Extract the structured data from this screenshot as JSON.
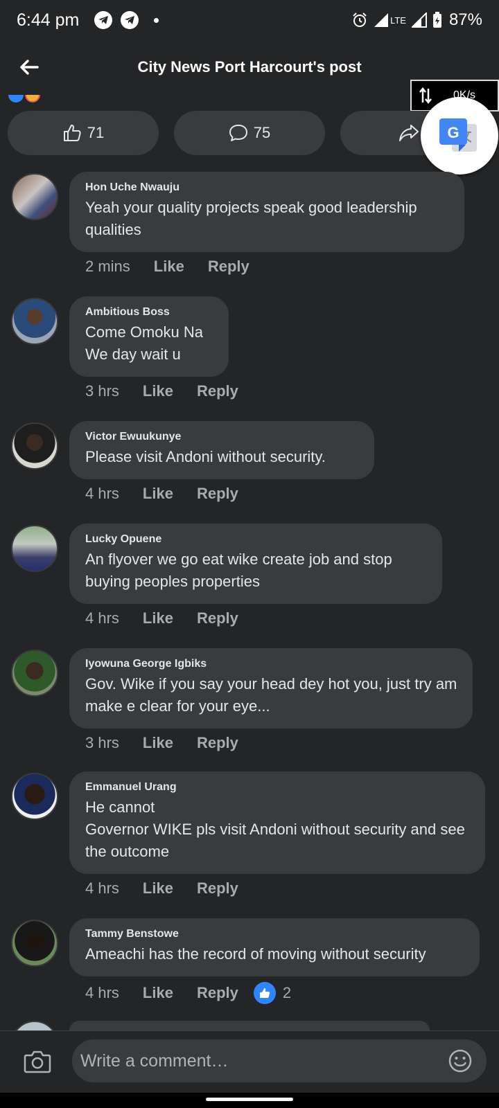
{
  "status_bar": {
    "time": "6:44 pm",
    "network": "LTE",
    "battery": "87%"
  },
  "header": {
    "title": "City News Port Harcourt's post"
  },
  "speed_indicator": {
    "value": "0K/s"
  },
  "actions": {
    "like_count": "71",
    "comment_count": "75"
  },
  "comments": [
    {
      "author": "Hon Uche Nwauju",
      "text": "Yeah your quality projects speak good leadership qualities",
      "time": "2 mins",
      "like_label": "Like",
      "reply_label": "Reply"
    },
    {
      "author": "Ambitious Boss",
      "text": "Come Omoku Na\nWe day wait u",
      "time": "3 hrs",
      "like_label": "Like",
      "reply_label": "Reply"
    },
    {
      "author": "Victor Ewuukunye",
      "text": "Please  visit Andoni without security.",
      "time": "4 hrs",
      "like_label": "Like",
      "reply_label": "Reply"
    },
    {
      "author": "Lucky Opuene",
      "text": "An flyover we go eat wike create job and  stop buying peoples properties",
      "time": "4 hrs",
      "like_label": "Like",
      "reply_label": "Reply"
    },
    {
      "author": "Iyowuna George Igbiks",
      "text": "Gov. Wike if you say your head dey hot you, just try am make e clear for your eye...",
      "time": "3 hrs",
      "like_label": "Like",
      "reply_label": "Reply"
    },
    {
      "author": "Emmanuel Urang",
      "text": "He cannot\nGovernor WIKE pls visit Andoni without security and see the outcome",
      "time": "4 hrs",
      "like_label": "Like",
      "reply_label": "Reply"
    },
    {
      "author": "Tammy Benstowe",
      "text": "Ameachi has the record of moving without security",
      "time": "4 hrs",
      "like_label": "Like",
      "reply_label": "Reply",
      "reaction_count": "2"
    }
  ],
  "composer": {
    "placeholder": "Write a comment…"
  },
  "icons": {
    "back": "back-arrow-icon",
    "like": "thumbs-up-icon",
    "comment": "comment-icon",
    "share": "share-icon",
    "translate": "google-translate-icon",
    "camera": "camera-icon",
    "emoji": "emoji-icon"
  },
  "colors": {
    "background": "#242527",
    "bubble": "#3a3b3c",
    "like_blue": "#2d86ff",
    "muted_text": "#a8abaf"
  }
}
